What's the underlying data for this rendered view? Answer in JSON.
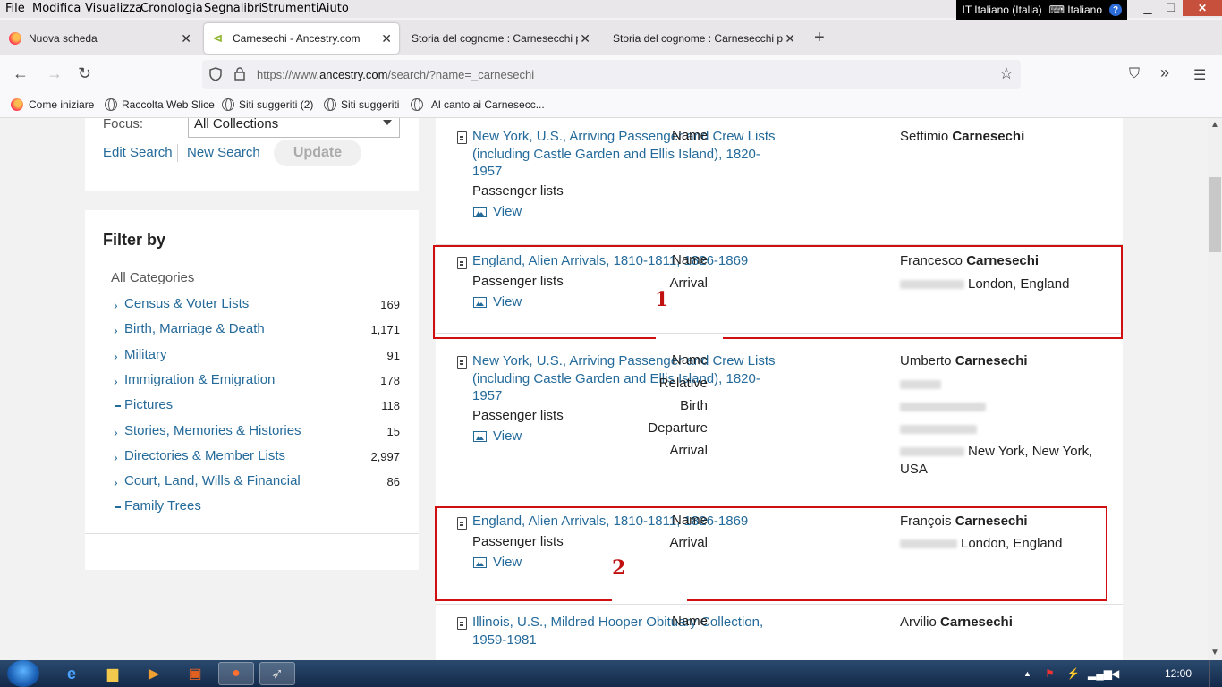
{
  "menubar": {
    "items": [
      {
        "label": "File",
        "u": "F"
      },
      {
        "label": "Modifica"
      },
      {
        "label": "Visualizza"
      },
      {
        "label": "Cronologia"
      },
      {
        "label": "Segnalibri"
      },
      {
        "label": "Strumenti"
      },
      {
        "label": "Aiuto"
      }
    ],
    "lang_code": "IT Italiano (Italia)",
    "keyboard": "Italiano",
    "help": "?"
  },
  "tabs": [
    {
      "label": "Nuova scheda",
      "active": false
    },
    {
      "label": "Carnesechi - Ancestry.com",
      "active": true
    },
    {
      "label": "Storia del cognome : Carnesecchi p",
      "active": false
    },
    {
      "label": "Storia del cognome : Carnesecchi p",
      "active": false
    }
  ],
  "url": {
    "prefix": "https://www.",
    "domain": "ancestry.com",
    "path": "/search/?name=_carnesechi"
  },
  "bookmarks": [
    "Come iniziare",
    "Raccolta Web Slice",
    "Siti suggeriti (2)",
    "Siti suggeriti",
    "Al canto ai Carnesecc..."
  ],
  "search": {
    "focus_label": "Focus:",
    "focus_value": "All Collections",
    "edit_search": "Edit Search",
    "new_search": "New Search",
    "update": "Update"
  },
  "filter": {
    "title": "Filter by",
    "all_categories": "All Categories",
    "items": [
      {
        "label": "Census & Voter Lists",
        "count": "169",
        "mode": "chevron"
      },
      {
        "label": "Birth, Marriage & Death",
        "count": "1,171",
        "mode": "chevron"
      },
      {
        "label": "Military",
        "count": "91",
        "mode": "chevron"
      },
      {
        "label": "Immigration & Emigration",
        "count": "178",
        "mode": "chevron"
      },
      {
        "label": "Pictures",
        "count": "118",
        "mode": "dash"
      },
      {
        "label": "Stories, Memories & Histories",
        "count": "15",
        "mode": "chevron"
      },
      {
        "label": "Directories & Member Lists",
        "count": "2,997",
        "mode": "chevron"
      },
      {
        "label": "Court, Land, Wills & Financial",
        "count": "86",
        "mode": "chevron"
      },
      {
        "label": "Family Trees",
        "count": "",
        "mode": "dash"
      }
    ]
  },
  "results": [
    {
      "title": "New York, U.S., Arriving Passenger and Crew Lists (including Castle Garden and Ellis Island), 1820-1957",
      "category": "Passenger lists",
      "view": "View",
      "fields": [
        {
          "label": "Name",
          "given": "Settimio",
          "surname": "Carnesechi"
        }
      ]
    },
    {
      "title": "England, Alien Arrivals, 1810-1811, 1826-1869",
      "category": "Passenger lists",
      "view": "View",
      "fields": [
        {
          "label": "Name",
          "given": "Francesco",
          "surname": "Carnesechi"
        },
        {
          "label": "Arrival",
          "value": "London, England"
        }
      ]
    },
    {
      "title": "New York, U.S., Arriving Passenger and Crew Lists (including Castle Garden and Ellis Island), 1820-1957",
      "category": "Passenger lists",
      "view": "View",
      "fields": [
        {
          "label": "Name",
          "given": "Umberto",
          "surname": "Carnesechi"
        },
        {
          "label": "Relative",
          "value": ""
        },
        {
          "label": "Birth",
          "value": ""
        },
        {
          "label": "Departure",
          "value": ""
        },
        {
          "label": "Arrival",
          "value": "New York, New York, USA"
        }
      ]
    },
    {
      "title": "England, Alien Arrivals, 1810-1811, 1826-1869",
      "category": "Passenger lists",
      "view": "View",
      "fields": [
        {
          "label": "Name",
          "given": "François",
          "surname": "Carnesechi"
        },
        {
          "label": "Arrival",
          "value": "London, England"
        }
      ]
    },
    {
      "title": "Illinois, U.S., Mildred Hooper Obituary Collection, 1959-1981",
      "fields": [
        {
          "label": "Name",
          "given": "Arvilio",
          "surname": "Carnesechi"
        }
      ]
    }
  ],
  "annotations": [
    "1",
    "2"
  ],
  "taskbar": {
    "clock": "12:00"
  },
  "colors": {
    "link": "#246a9a",
    "highlight": "#d01010",
    "taskbar": "#1c3557"
  }
}
